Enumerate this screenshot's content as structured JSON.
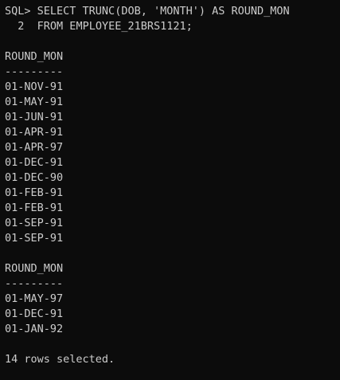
{
  "terminal": {
    "prompt": "SQL>",
    "query_line_1": "SELECT TRUNC(DOB, 'MONTH') AS ROUND_MON",
    "query_line_2_number": "2",
    "query_line_2": "FROM EMPLOYEE_21BRS1121;",
    "colors": {
      "background": "#0c0c0c",
      "text": "#cccccc"
    }
  },
  "result_blocks": [
    {
      "header": "ROUND_MON",
      "separator": "---------",
      "rows": [
        "01-NOV-91",
        "01-MAY-91",
        "01-JUN-91",
        "01-APR-91",
        "01-APR-97",
        "01-DEC-91",
        "01-DEC-90",
        "01-FEB-91",
        "01-FEB-91",
        "01-SEP-91",
        "01-SEP-91"
      ]
    },
    {
      "header": "ROUND_MON",
      "separator": "---------",
      "rows": [
        "01-MAY-97",
        "01-DEC-91",
        "01-JAN-92"
      ]
    }
  ],
  "footer": {
    "rows_selected": "14 rows selected."
  }
}
